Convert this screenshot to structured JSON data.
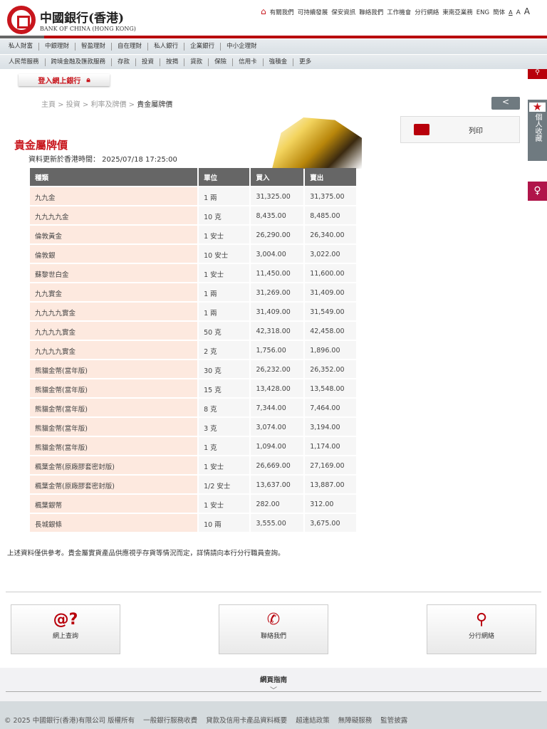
{
  "header": {
    "logo_cn": "中國銀行(香港)",
    "logo_en": "BANK OF CHINA (HONG KONG)",
    "top_links": [
      "有關我們",
      "可持續發展",
      "保安資訊",
      "聯絡我們",
      "工作機會",
      "分行網絡",
      "東南亞業務",
      "ENG",
      "簡体"
    ],
    "font_sizes": [
      "A",
      "A",
      "A"
    ]
  },
  "nav1": [
    "私人財富",
    "中銀理財",
    "智盈理財",
    "自在理財",
    "私人銀行",
    "企業銀行",
    "中小企理財"
  ],
  "nav2": [
    "人民幣服務",
    "跨境金融及匯款服務",
    "存款",
    "投資",
    "按揭",
    "貸款",
    "保險",
    "信用卡",
    "強積金",
    "更多"
  ],
  "login_label": "登入網上銀行",
  "breadcrumb": [
    "主頁",
    "投資",
    "利率及牌價",
    "貴金屬牌價"
  ],
  "print_label": "列印",
  "favorites_label": "個人收藏",
  "page_title": "貴金屬牌價",
  "updated": "資料更新於香港時間： 2025/07/18 17:25:00",
  "table": {
    "headers": [
      "種類",
      "單位",
      "買入",
      "賣出"
    ],
    "rows": [
      [
        "九九金",
        "1 兩",
        "31,325.00",
        "31,375.00"
      ],
      [
        "九九九九金",
        "10 克",
        "8,435.00",
        "8,485.00"
      ],
      [
        "倫敦黃金",
        "1 安士",
        "26,290.00",
        "26,340.00"
      ],
      [
        "倫敦銀",
        "10 安士",
        "3,004.00",
        "3,022.00"
      ],
      [
        "蘇黎世白金",
        "1 安士",
        "11,450.00",
        "11,600.00"
      ],
      [
        "九九實金",
        "1 兩",
        "31,269.00",
        "31,409.00"
      ],
      [
        "九九九九實金",
        "1 兩",
        "31,409.00",
        "31,549.00"
      ],
      [
        "九九九九實金",
        "50 克",
        "42,318.00",
        "42,458.00"
      ],
      [
        "九九九九實金",
        "2 克",
        "1,756.00",
        "1,896.00"
      ],
      [
        "熊貓金幣(當年版)",
        "30 克",
        "26,232.00",
        "26,352.00"
      ],
      [
        "熊貓金幣(當年版)",
        "15 克",
        "13,428.00",
        "13,548.00"
      ],
      [
        "熊貓金幣(當年版)",
        "8 克",
        "7,344.00",
        "7,464.00"
      ],
      [
        "熊貓金幣(當年版)",
        "3 克",
        "3,074.00",
        "3,194.00"
      ],
      [
        "熊貓金幣(當年版)",
        "1 克",
        "1,094.00",
        "1,174.00"
      ],
      [
        "楓葉金幣(原廠膠套密封版)",
        "1 安士",
        "26,669.00",
        "27,169.00"
      ],
      [
        "楓葉金幣(原廠膠套密封版)",
        "1/2 安士",
        "13,637.00",
        "13,887.00"
      ],
      [
        "楓葉銀幣",
        "1 安士",
        "282.00",
        "312.00"
      ],
      [
        "長城銀條",
        "10 兩",
        "3,555.00",
        "3,675.00"
      ]
    ]
  },
  "note": "上述資料僅供參考。貴金屬實貨產品供應視乎存貨等情況而定，詳情請向本行分行職員查詢。",
  "cards": [
    "網上查詢",
    "聯絡我們",
    "分行網絡"
  ],
  "guide_label": "網頁指南",
  "footer": [
    "© 2025 中國銀行(香港)有限公司 版權所有",
    "一般銀行服務收費",
    "貸款及信用卡產品資料概要",
    "超連結政策",
    "無障礙服務",
    "監管披露"
  ]
}
